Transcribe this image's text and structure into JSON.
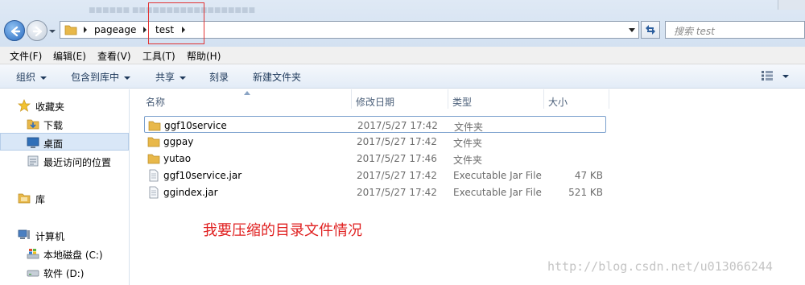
{
  "address": {
    "crumbs": [
      "pageage",
      "test"
    ],
    "search_placeholder": "搜索 test",
    "blurred_title": "■■■■■■ ■■■■■■■■■■■■■■■■■■"
  },
  "menu": {
    "items": [
      "文件(F)",
      "编辑(E)",
      "查看(V)",
      "工具(T)",
      "帮助(H)"
    ]
  },
  "toolbar": {
    "organize": "组织",
    "include_in_library": "包含到库中",
    "share": "共享",
    "burn": "刻录",
    "new_folder": "新建文件夹"
  },
  "nav": {
    "favorites": "收藏夹",
    "downloads": "下载",
    "desktop": "桌面",
    "recent": "最近访问的位置",
    "libraries": "库",
    "computer": "计算机",
    "local_disk": "本地磁盘 (C:)",
    "software": "软件 (D:)"
  },
  "columns": {
    "name": "名称",
    "modified": "修改日期",
    "type": "类型",
    "size": "大小"
  },
  "files": [
    {
      "name": "ggf10service",
      "modified": "2017/5/27 17:42",
      "type": "文件夹",
      "size": "",
      "kind": "folder"
    },
    {
      "name": "ggpay",
      "modified": "2017/5/27 17:42",
      "type": "文件夹",
      "size": "",
      "kind": "folder"
    },
    {
      "name": "yutao",
      "modified": "2017/5/27 17:46",
      "type": "文件夹",
      "size": "",
      "kind": "folder"
    },
    {
      "name": "ggf10service.jar",
      "modified": "2017/5/27 17:42",
      "type": "Executable Jar File",
      "size": "47 KB",
      "kind": "jar"
    },
    {
      "name": "ggindex.jar",
      "modified": "2017/5/27 17:42",
      "type": "Executable Jar File",
      "size": "521 KB",
      "kind": "jar"
    }
  ],
  "annotation": "我要压缩的目录文件情况",
  "watermark": "http://blog.csdn.net/u013066244",
  "colors": {
    "annotation": "#e02020",
    "highlight_box": "#e23333",
    "folder": "#e8b84a"
  }
}
